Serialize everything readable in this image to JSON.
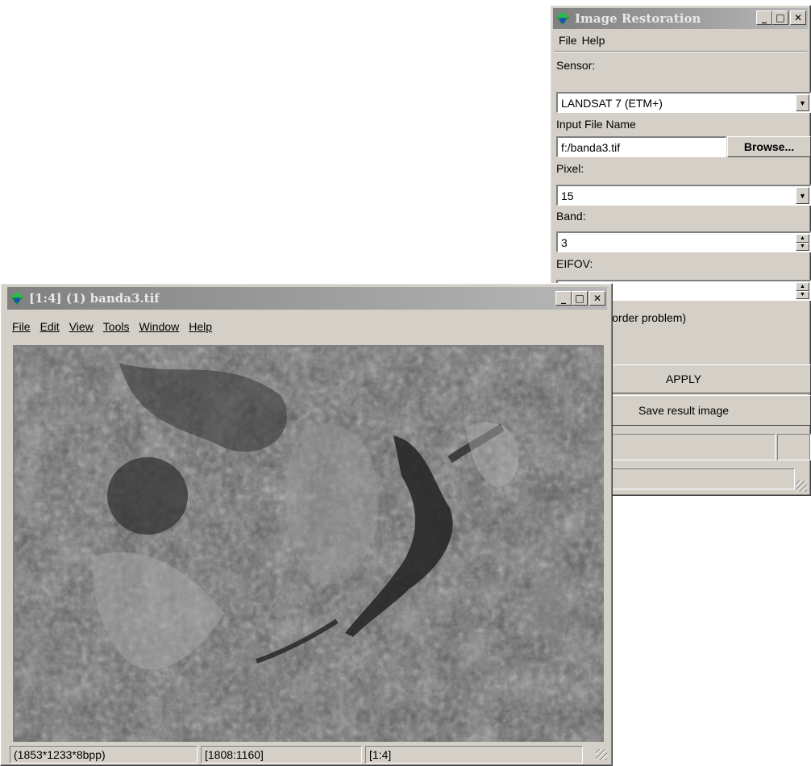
{
  "restoration": {
    "title": "Image Restoration",
    "menu": [
      "File",
      "Help"
    ],
    "sensor_label": "Sensor:",
    "sensor_value": "LANDSAT 7 (ETM+)",
    "input_label": "Input File Name",
    "input_value": "f:/banda3.tif",
    "browse_label": "Browse...",
    "pixel_label": "Pixel:",
    "pixel_value": "15",
    "band_label": "Band:",
    "band_value": "3",
    "eifov_label": "EIFOV:",
    "eifov_value": "",
    "checkbox_text": "y source (border problem)",
    "apply_label": "APPLY",
    "save_label": "Save result image"
  },
  "viewer": {
    "title": "[1:4] (1) banda3.tif",
    "menu": {
      "file": "File",
      "edit": "Edit",
      "view": "View",
      "tools": "Tools",
      "window": "Window",
      "help": "Help"
    },
    "status": [
      "(1853*1233*8bpp)",
      "[1808:1160]",
      "[1:4]"
    ]
  },
  "titlebar_buttons": {
    "minimize": "_",
    "maximize": "□",
    "close": "✕"
  },
  "colors": {
    "title_gradient_start": "#808080",
    "title_gradient_end": "#b8b8b8",
    "face": "#d4d0c8"
  }
}
